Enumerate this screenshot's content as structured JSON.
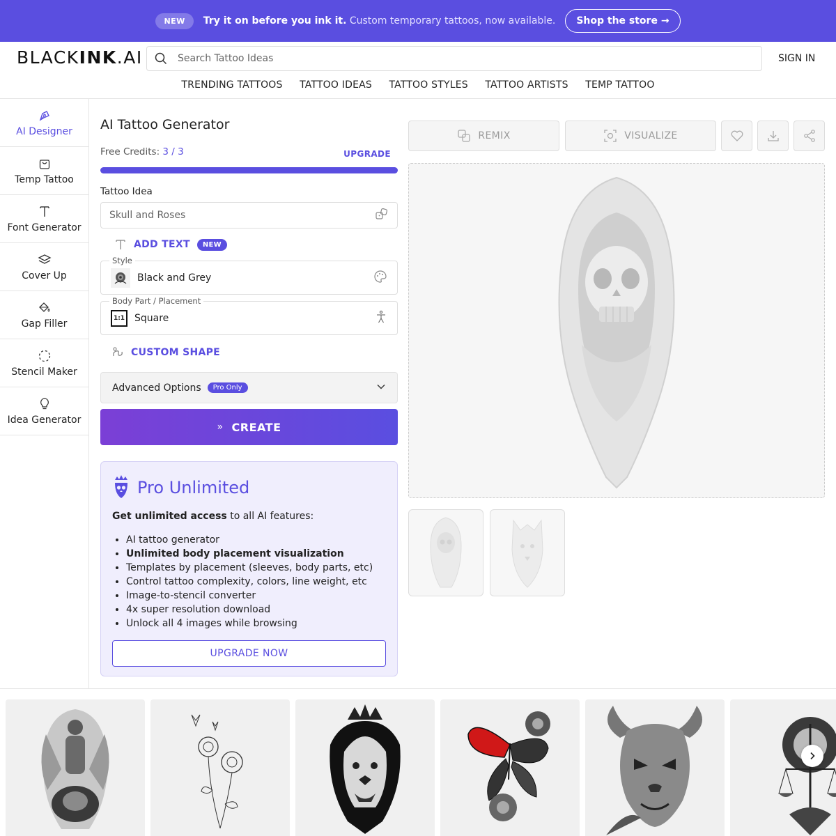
{
  "promo": {
    "badge": "NEW",
    "headline": "Try it on before you ink it.",
    "subtext": "Custom temporary tattoos, now available.",
    "shop_label": "Shop the store →"
  },
  "header": {
    "logo_thin": "BLACK",
    "logo_bold": "INK",
    "logo_suffix": ".AI",
    "search_placeholder": "Search Tattoo Ideas",
    "signin": "SIGN IN",
    "nav": [
      "TRENDING TATTOOS",
      "TATTOO IDEAS",
      "TATTOO STYLES",
      "TATTOO ARTISTS",
      "TEMP TATTOO"
    ]
  },
  "sidebar": {
    "items": [
      {
        "label": "AI Designer",
        "icon": "pen-nib-icon",
        "active": true
      },
      {
        "label": "Temp Tattoo",
        "icon": "shopping-bag-icon"
      },
      {
        "label": "Font Generator",
        "icon": "type-icon"
      },
      {
        "label": "Cover Up",
        "icon": "layers-icon"
      },
      {
        "label": "Gap Filler",
        "icon": "paint-bucket-icon"
      },
      {
        "label": "Stencil Maker",
        "icon": "dashed-circle-icon"
      },
      {
        "label": "Idea Generator",
        "icon": "lightbulb-icon"
      }
    ]
  },
  "generator": {
    "title": "AI Tattoo Generator",
    "credits_label": "Free Credits:",
    "credits_value": "3 / 3",
    "credits_fraction": 1.0,
    "upgrade_label": "UPGRADE",
    "idea_label": "Tattoo Idea",
    "idea_placeholder": "Skull and Roses",
    "add_text_label": "ADD TEXT",
    "add_text_badge": "NEW",
    "style_legend": "Style",
    "style_value": "Black and Grey",
    "placement_legend": "Body Part / Placement",
    "placement_value": "Square",
    "placement_thumb": "1:1",
    "custom_shape_label": "CUSTOM SHAPE",
    "advanced_label": "Advanced Options",
    "advanced_badge": "Pro Only",
    "create_label": "CREATE"
  },
  "pro": {
    "title": "Pro Unlimited",
    "intro_bold": "Get unlimited access",
    "intro_rest": " to all AI features:",
    "features": [
      "AI tattoo generator",
      "Unlimited body placement visualization",
      "Templates by placement (sleeves, body parts, etc)",
      "Control tattoo complexity, colors, line weight, etc",
      "Image-to-stencil converter",
      "4x super resolution download",
      "Unlock all 4 images while browsing"
    ],
    "button_label": "UPGRADE NOW"
  },
  "toolbar": {
    "remix_label": "REMIX",
    "visualize_label": "VISUALIZE"
  },
  "colors": {
    "accent": "#5a4ee0",
    "banner": "#5a4ee0",
    "butterfly_red": "#d01818"
  }
}
